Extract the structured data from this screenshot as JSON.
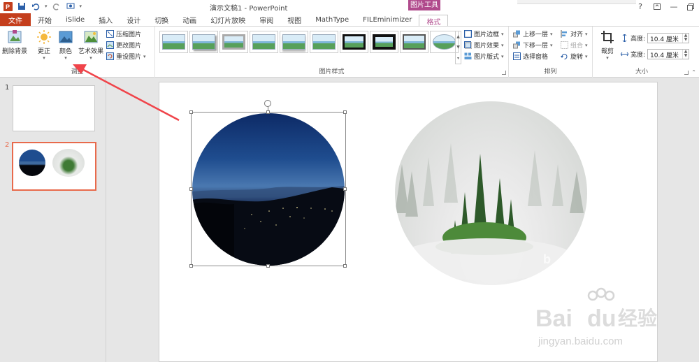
{
  "title_bar": {
    "window_title": "演示文稿1 - PowerPoint",
    "context_tab_label": "图片工具",
    "help": "?",
    "minimize": "—"
  },
  "tabs": [
    {
      "label": "文件"
    },
    {
      "label": "开始"
    },
    {
      "label": "iSlide"
    },
    {
      "label": "插入"
    },
    {
      "label": "设计"
    },
    {
      "label": "切换"
    },
    {
      "label": "动画"
    },
    {
      "label": "幻灯片放映"
    },
    {
      "label": "审阅"
    },
    {
      "label": "视图"
    },
    {
      "label": "MathType"
    },
    {
      "label": "FILEminimizer"
    },
    {
      "label": "格式"
    }
  ],
  "ribbon": {
    "adjust": {
      "remove_bg": "删除背景",
      "corrections": "更正",
      "color": "颜色",
      "artistic": "艺术效果",
      "compress": "压缩图片",
      "change": "更改图片",
      "reset": "重设图片",
      "group_label": "调整"
    },
    "styles": {
      "border": "图片边框",
      "effects": "图片效果",
      "layout": "图片版式",
      "group_label": "图片样式"
    },
    "arrange": {
      "bring_forward": "上移一层",
      "send_backward": "下移一层",
      "selection_pane": "选择窗格",
      "align": "对齐",
      "group": "组合",
      "rotate": "旋转",
      "group_label": "排列"
    },
    "size": {
      "crop": "裁剪",
      "height_label": "高度:",
      "height_value": "10.4 厘米",
      "width_label": "宽度:",
      "width_value": "10.4 厘米",
      "group_label": "大小"
    }
  },
  "slides": [
    {
      "number": "1"
    },
    {
      "number": "2"
    }
  ]
}
